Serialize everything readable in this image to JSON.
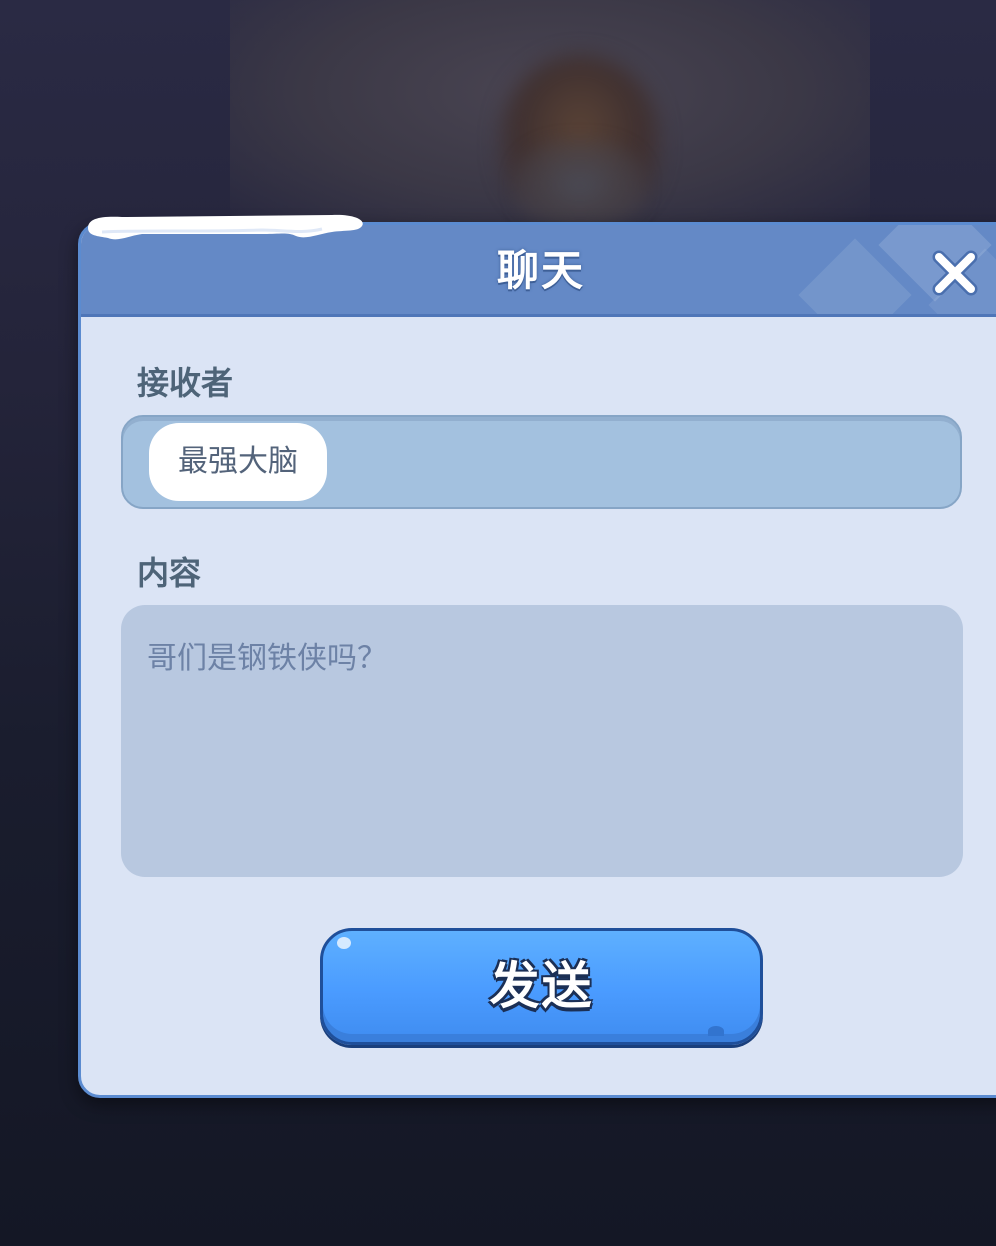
{
  "dialog": {
    "title": "聊天",
    "close_icon": "close-x-icon"
  },
  "recipient": {
    "label": "接收者",
    "chip_name": "最强大脑"
  },
  "content": {
    "label": "内容",
    "text": "哥们是钢铁侠吗？"
  },
  "send_button": {
    "label": "发送"
  },
  "colors": {
    "header": "#6489c6",
    "panel": "#dbe4f5",
    "button": "#4a9bff"
  }
}
